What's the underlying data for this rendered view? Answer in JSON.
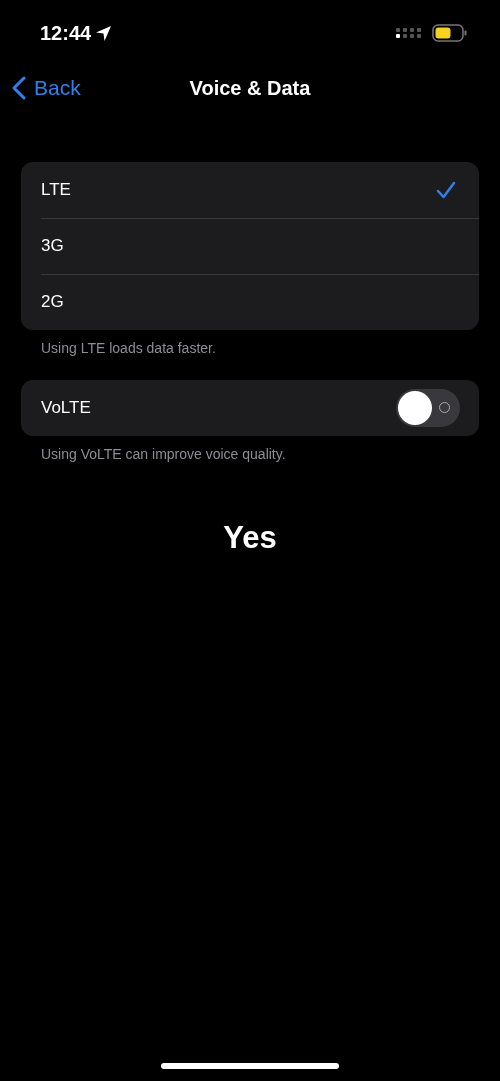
{
  "status_bar": {
    "time": "12:44"
  },
  "nav": {
    "back": "Back",
    "title": "Voice & Data"
  },
  "options": [
    {
      "label": "LTE",
      "selected": true
    },
    {
      "label": "3G",
      "selected": false
    },
    {
      "label": "2G",
      "selected": false
    }
  ],
  "options_footer": "Using LTE loads data faster.",
  "volte": {
    "label": "VoLTE",
    "on": false
  },
  "volte_footer": "Using VoLTE can improve voice quality.",
  "answer": "Yes"
}
